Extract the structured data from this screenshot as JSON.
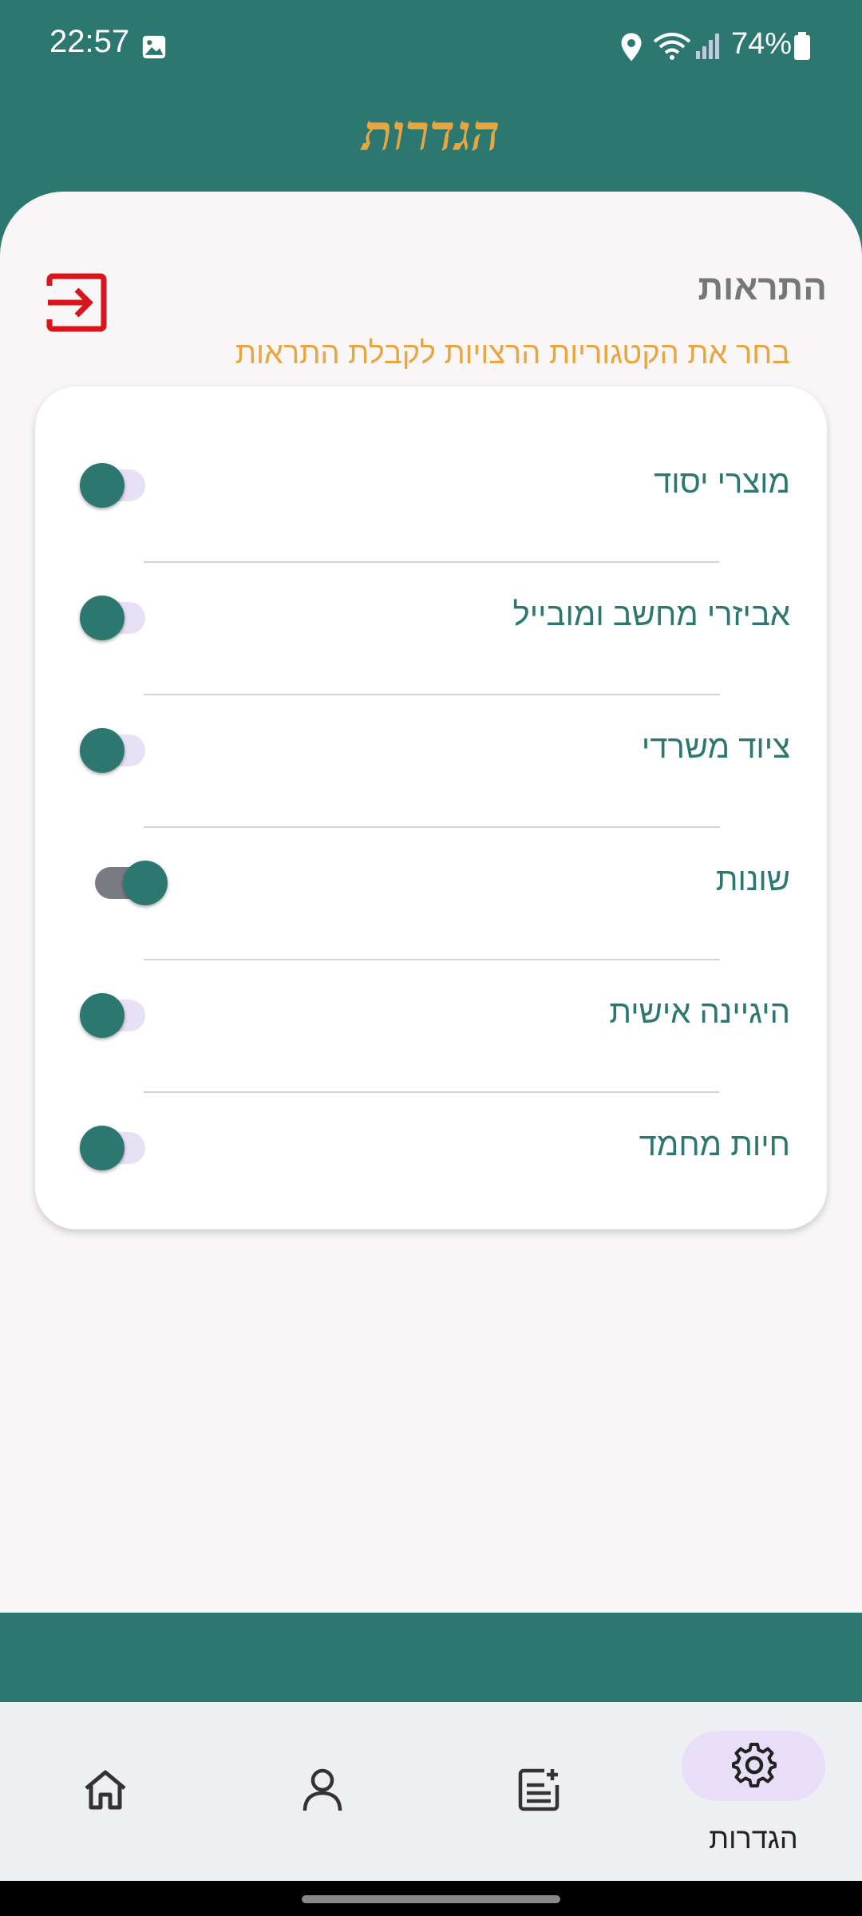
{
  "status_bar": {
    "time": "22:57",
    "battery": "74%",
    "icons": [
      "image-icon",
      "location-icon",
      "wifi-icon",
      "signal-icon",
      "battery-icon"
    ]
  },
  "header": {
    "title": "הגדרות"
  },
  "notifications": {
    "title": "התראות",
    "subtitle": "בחר את הקטגוריות הרצויות לקבלת התראות",
    "logout_icon": "logout-icon",
    "items": [
      {
        "label": "מוצרי יסוד",
        "enabled": false
      },
      {
        "label": "אביזרי מחשב ומובייל",
        "enabled": false
      },
      {
        "label": "ציוד משרדי",
        "enabled": false
      },
      {
        "label": "שונות",
        "enabled": true
      },
      {
        "label": "היגיינה אישית",
        "enabled": false
      },
      {
        "label": "חיות מחמד",
        "enabled": false
      }
    ]
  },
  "bottom_nav": {
    "items": [
      {
        "icon": "home-icon",
        "label": ""
      },
      {
        "icon": "profile-icon",
        "label": ""
      },
      {
        "icon": "add-list-icon",
        "label": ""
      },
      {
        "icon": "settings-icon",
        "label": "הגדרות",
        "active": true
      }
    ]
  },
  "colors": {
    "primary": "#2c7870",
    "accent": "#e8a640",
    "logout": "#d9141a",
    "nav_active_pill": "#e8def8"
  }
}
